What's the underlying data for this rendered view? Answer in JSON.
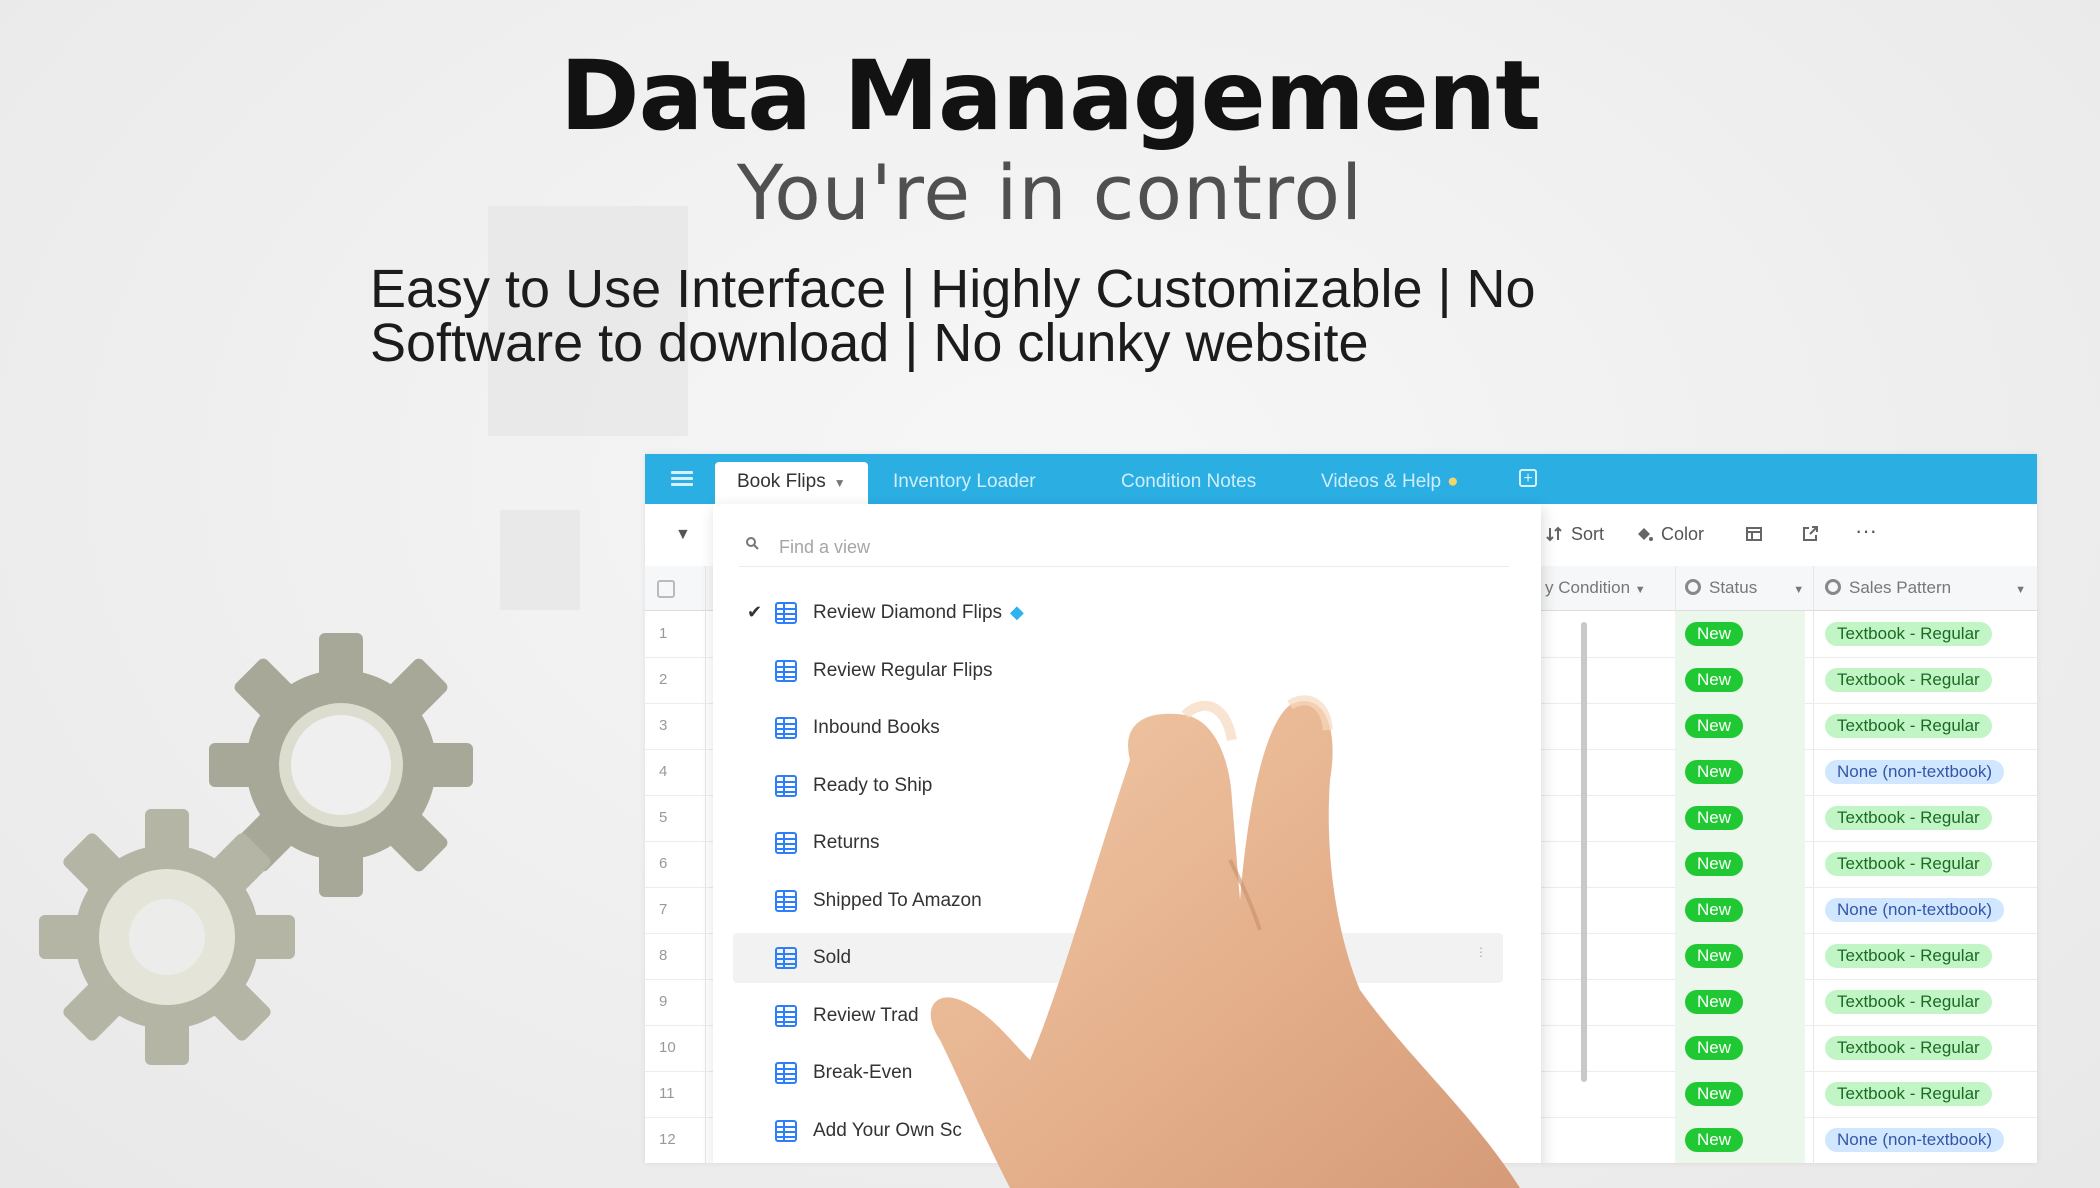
{
  "hero": {
    "title": "Data Management",
    "subtitle": "You're in control",
    "tagline_line1": "Easy to Use Interface | Highly Customizable | No",
    "tagline_line2": "Software to download | No clunky website"
  },
  "app": {
    "tabs": [
      {
        "label": "Book Flips"
      },
      {
        "label": "Inventory Loader"
      },
      {
        "label": "Condition Notes"
      },
      {
        "label": "Videos & Help"
      }
    ],
    "toolbar": {
      "sort": "Sort",
      "color": "Color"
    },
    "columns": {
      "condition": "y Condition",
      "status": "Status",
      "sales_pattern": "Sales Pattern"
    },
    "rows": [
      {
        "num": "1",
        "status": "New",
        "pattern": "Textbook - Regular"
      },
      {
        "num": "2",
        "status": "New",
        "pattern": "Textbook - Regular"
      },
      {
        "num": "3",
        "status": "New",
        "pattern": "Textbook - Regular"
      },
      {
        "num": "4",
        "status": "New",
        "pattern": "None (non-textbook)"
      },
      {
        "num": "5",
        "status": "New",
        "pattern": "Textbook - Regular"
      },
      {
        "num": "6",
        "status": "New",
        "pattern": "Textbook - Regular"
      },
      {
        "num": "7",
        "status": "New",
        "pattern": "None (non-textbook)"
      },
      {
        "num": "8",
        "status": "New",
        "pattern": "Textbook - Regular"
      },
      {
        "num": "9",
        "status": "New",
        "pattern": "Textbook - Regular"
      },
      {
        "num": "10",
        "status": "New",
        "pattern": "Textbook - Regular"
      },
      {
        "num": "11",
        "status": "New",
        "pattern": "Textbook - Regular"
      },
      {
        "num": "12",
        "status": "New",
        "pattern": "None (non-textbook)"
      }
    ],
    "view_menu": {
      "search_placeholder": "Find a view",
      "views": [
        {
          "label": "Review Diamond Flips",
          "checked": true
        },
        {
          "label": "Review Regular Flips"
        },
        {
          "label": "Inbound Books"
        },
        {
          "label": "Ready to Ship"
        },
        {
          "label": "Returns"
        },
        {
          "label": "Shipped To Amazon"
        },
        {
          "label": "Sold"
        },
        {
          "label": "Review Trad"
        },
        {
          "label": "Break-Even"
        },
        {
          "label": "Add Your Own Sc"
        }
      ]
    }
  },
  "colors": {
    "tabbar": "#2baee2",
    "status_new": "#20c933",
    "textbook_pill": "#c2f5c6",
    "none_pill": "#d0e7ff",
    "gear": "#a8a898"
  },
  "icons": [
    "menu-icon",
    "search-icon",
    "grid-view-icon",
    "check-icon",
    "diamond-icon",
    "gear-icon",
    "sort-icon",
    "color-bucket-icon",
    "fields-icon",
    "share-icon",
    "more-icon",
    "add-tab-icon"
  ]
}
